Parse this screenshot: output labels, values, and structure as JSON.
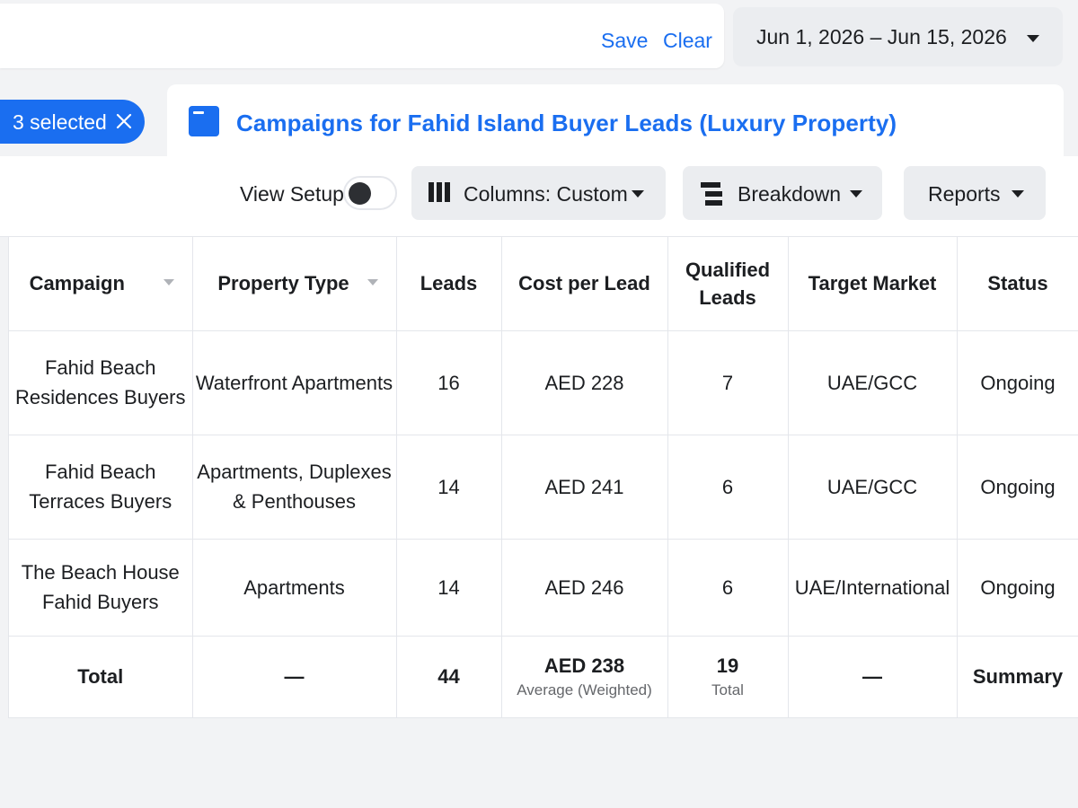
{
  "toolbar": {
    "save_label": "Save",
    "clear_label": "Clear",
    "date_range": "Jun 1, 2026 – Jun 15, 2026"
  },
  "selection": {
    "label": "3 selected"
  },
  "campaign_group": {
    "title": "Campaigns for Fahid Island Buyer Leads (Luxury Property)"
  },
  "controls": {
    "view_setup_label": "View Setup",
    "view_setup_on": false,
    "columns_label": "Columns: Custom",
    "breakdown_label": "Breakdown",
    "reports_label": "Reports"
  },
  "table": {
    "headers": {
      "campaign": "Campaign",
      "property_type": "Property Type",
      "leads": "Leads",
      "cost_per_lead": "Cost per Lead",
      "qualified_leads_1": "Qualified",
      "qualified_leads_2": "Leads",
      "target_market": "Target Market",
      "status": "Status"
    },
    "rows": [
      {
        "campaign_1": "Fahid Beach",
        "campaign_2": "Residences Buyers",
        "property_type_1": "Waterfront Apartments",
        "property_type_2": "",
        "leads": "16",
        "cost_per_lead": "AED 228",
        "qualified_leads": "7",
        "target_market": "UAE/GCC",
        "status": "Ongoing"
      },
      {
        "campaign_1": "Fahid Beach",
        "campaign_2": "Terraces Buyers",
        "property_type_1": "Apartments, Duplexes",
        "property_type_2": "& Penthouses",
        "leads": "14",
        "cost_per_lead": "AED 241",
        "qualified_leads": "6",
        "target_market": "UAE/GCC",
        "status": "Ongoing"
      },
      {
        "campaign_1": "The Beach House",
        "campaign_2": "Fahid Buyers",
        "property_type_1": "Apartments",
        "property_type_2": "",
        "leads": "14",
        "cost_per_lead": "AED 246",
        "qualified_leads": "6",
        "target_market": "UAE/International",
        "status": "Ongoing"
      }
    ],
    "total": {
      "label": "Total",
      "property_type": "—",
      "leads": "44",
      "cost_per_lead": "AED 238",
      "cost_per_lead_note": "Average (Weighted)",
      "qualified_leads": "19",
      "qualified_leads_note": "Total",
      "target_market": "—",
      "status": "Summary"
    }
  },
  "colors": {
    "accent": "#1a6ef0",
    "panel": "#ffffff",
    "background": "#f2f3f5",
    "button_bg": "#ebedf0"
  },
  "icons": {
    "selection_close": "close-icon",
    "campaign_group": "folder-icon",
    "columns": "columns-icon",
    "breakdown": "breakdown-icon",
    "dropdown": "chevron-down-icon"
  }
}
